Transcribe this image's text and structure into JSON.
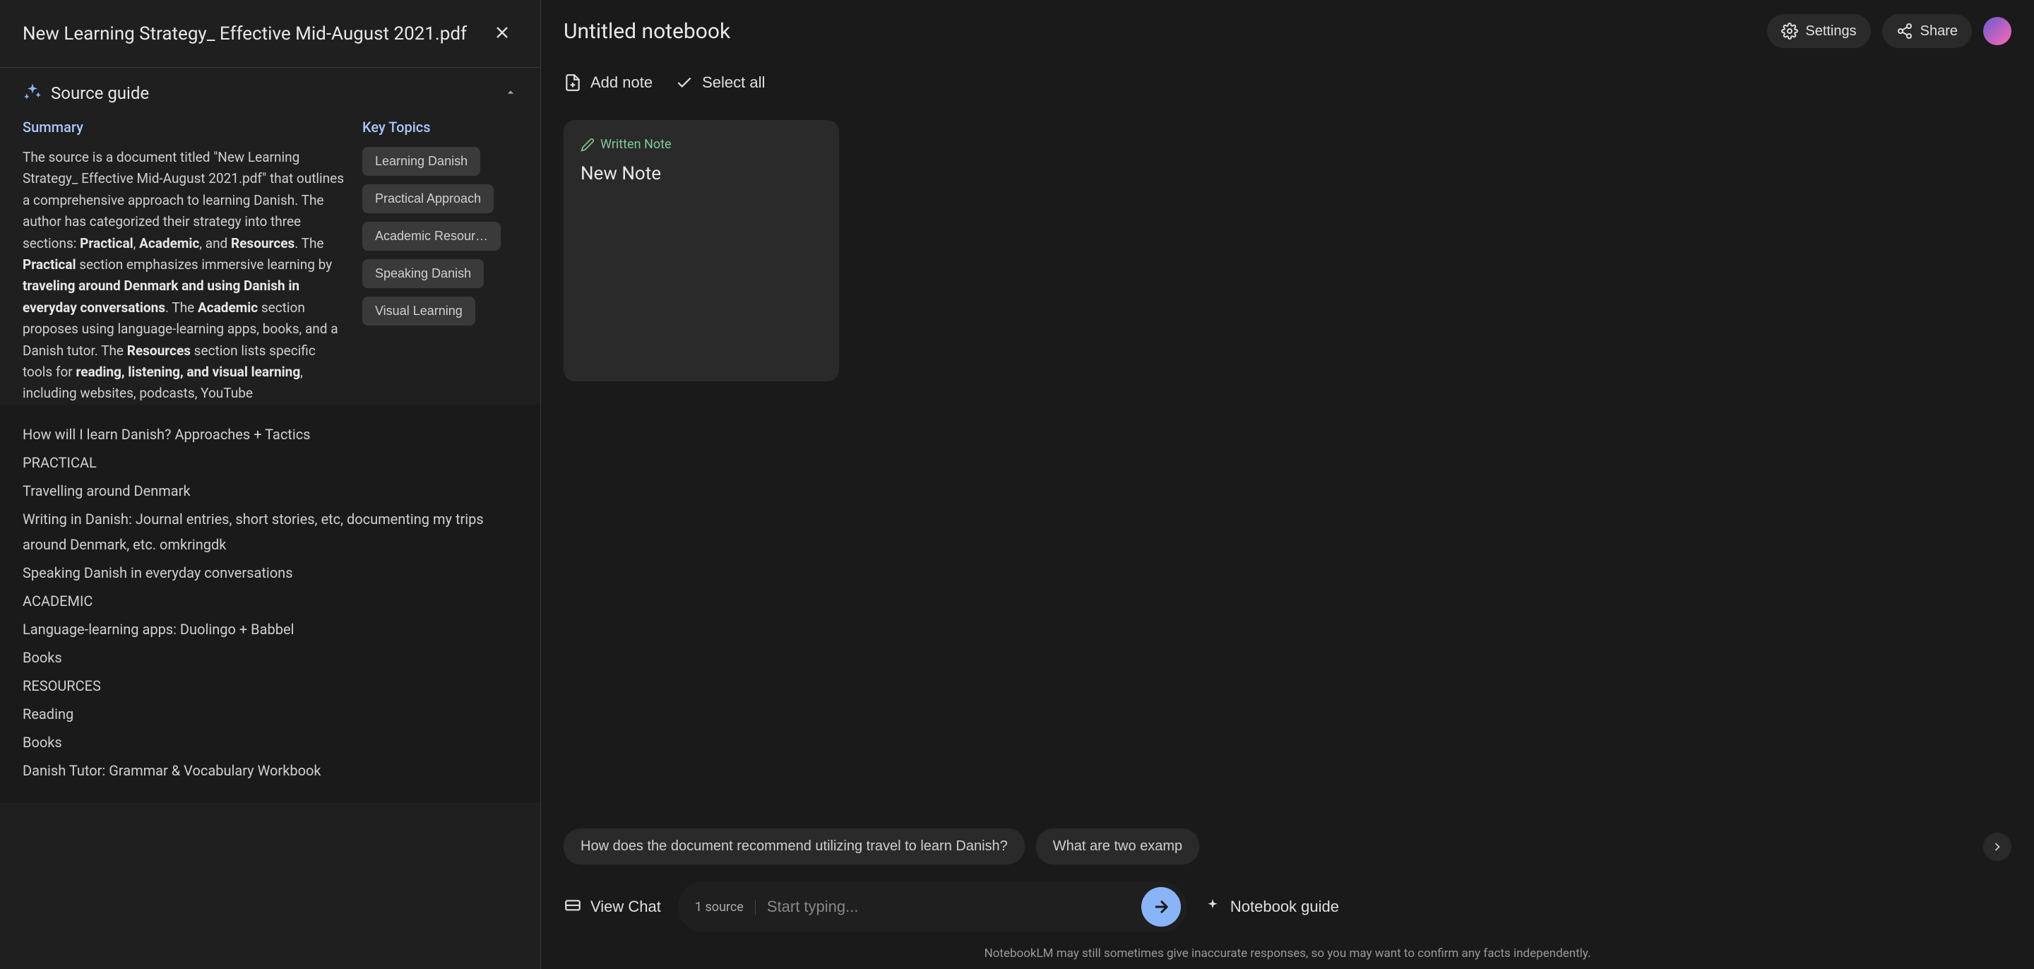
{
  "leftPanel": {
    "docTitle": "New Learning Strategy_ Effective Mid-August 2021.pdf",
    "sourceGuide": "Source guide",
    "summaryHeading": "Summary",
    "keyTopicsHeading": "Key Topics",
    "summary": {
      "part1": "The source is a document titled \"New Learning Strategy_ Effective Mid-August 2021.pdf\" that outlines a comprehensive approach to learning Danish. The author has categorized their strategy into three sections: ",
      "bold1": "Practical",
      "sep1": ", ",
      "bold2": "Academic",
      "sep2": ", and ",
      "bold3": "Resources",
      "part2": ". The ",
      "bold4": "Practical",
      "part3": " section emphasizes immersive learning by ",
      "bold5": "traveling around Denmark and using Danish in everyday conversations",
      "part4": ". The ",
      "bold6": "Academic",
      "part5": " section proposes using language-learning apps, books, and a Danish tutor. The ",
      "bold7": "Resources",
      "part6": " section lists specific tools for ",
      "bold8": "reading, listening, and visual learning",
      "part7": ", including websites, podcasts, YouTube"
    },
    "topics": [
      "Learning Danish",
      "Practical Approach",
      "Academic Resour…",
      "Speaking Danish",
      "Visual Learning"
    ],
    "docContent": [
      "How will I learn Danish? Approaches + Tactics",
      "PRACTICAL",
      "Travelling around Denmark",
      "Writing in Danish: Journal entries, short stories, etc, documenting my trips around Denmark, etc. omkringdk",
      "Speaking Danish in everyday conversations",
      "ACADEMIC",
      "Language-learning apps: Duolingo + Babbel",
      "Books",
      "RESOURCES",
      "Reading",
      "Books",
      "Danish Tutor: Grammar & Vocabulary Workbook"
    ]
  },
  "rightPanel": {
    "notebookTitle": "Untitled notebook",
    "settings": "Settings",
    "share": "Share",
    "addNote": "Add note",
    "selectAll": "Select all",
    "noteTag": "Written Note",
    "noteTitle": "New Note",
    "suggestions": [
      "How does the document recommend utilizing travel to learn Danish?",
      "What are two examp"
    ],
    "viewChat": "View Chat",
    "sourceCount": "1 source",
    "inputPlaceholder": "Start typing...",
    "notebookGuide": "Notebook guide",
    "disclaimer": "NotebookLM may still sometimes give inaccurate responses, so you may want to confirm any facts independently."
  }
}
